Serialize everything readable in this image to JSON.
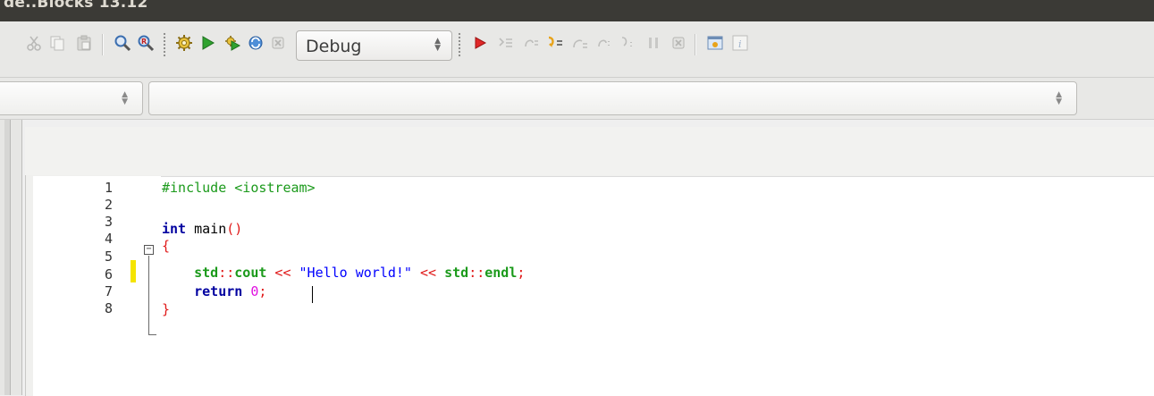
{
  "window": {
    "title": "de..Blocks 13.12"
  },
  "toolbar": {
    "build_target": "Debug",
    "icons": [
      "cut-icon",
      "copy-icon",
      "paste-icon",
      "find-icon",
      "replace-icon",
      "build-icon",
      "run-icon",
      "build-and-run-icon",
      "rebuild-icon",
      "abort-icon",
      "debug-run-icon",
      "run-to-cursor-icon",
      "next-line-icon",
      "step-into-icon",
      "step-out-icon",
      "next-instruction-icon",
      "step-into-instruction-icon",
      "break-debugger-icon",
      "stop-debugger-icon",
      "debug-windows-icon",
      "info-icon"
    ]
  },
  "editor": {
    "line_numbers": [
      "1",
      "2",
      "3",
      "4",
      "5",
      "6",
      "7",
      "8"
    ],
    "lines": [
      {
        "segments": [
          {
            "t": "#include <iostream>",
            "c": "pp"
          }
        ]
      },
      {
        "segments": []
      },
      {
        "segments": [
          {
            "t": "int",
            "c": "kw"
          },
          {
            "t": " main",
            "c": ""
          },
          {
            "t": "()",
            "c": "br"
          }
        ]
      },
      {
        "segments": [
          {
            "t": "{",
            "c": "br"
          }
        ]
      },
      {
        "segments": [
          {
            "t": "    ",
            "c": ""
          },
          {
            "t": "std",
            "c": "ns"
          },
          {
            "t": "::",
            "c": "op"
          },
          {
            "t": "cout",
            "c": "ns"
          },
          {
            "t": " << ",
            "c": "op"
          },
          {
            "t": "\"Hello world!\"",
            "c": "str"
          },
          {
            "t": " << ",
            "c": "op"
          },
          {
            "t": "std",
            "c": "ns"
          },
          {
            "t": "::",
            "c": "op"
          },
          {
            "t": "endl",
            "c": "ns"
          },
          {
            "t": ";",
            "c": "op"
          }
        ]
      },
      {
        "segments": [
          {
            "t": "    ",
            "c": ""
          },
          {
            "t": "return",
            "c": "kw"
          },
          {
            "t": " ",
            "c": ""
          },
          {
            "t": "0",
            "c": "num"
          },
          {
            "t": ";",
            "c": "op"
          }
        ]
      },
      {
        "segments": [
          {
            "t": "}",
            "c": "br"
          }
        ]
      },
      {
        "segments": []
      }
    ],
    "fold_marker": "−"
  }
}
